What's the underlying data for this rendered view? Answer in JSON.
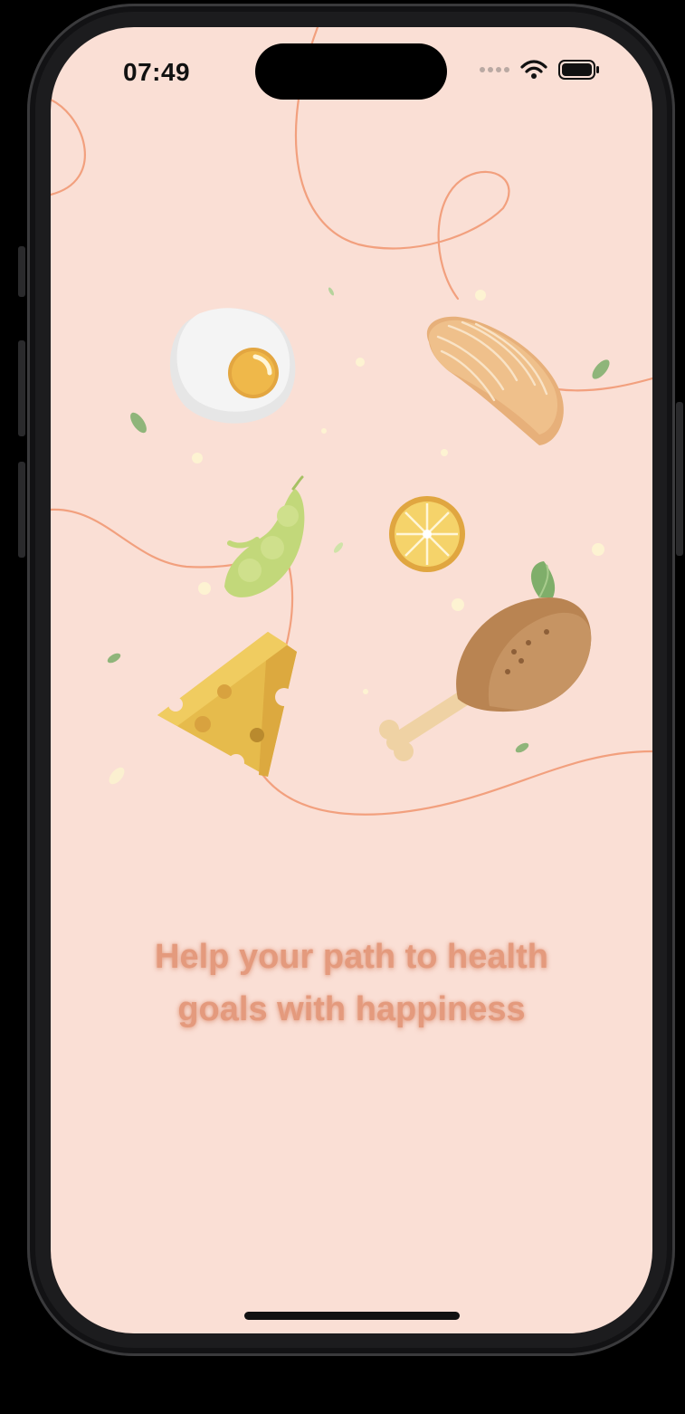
{
  "status_bar": {
    "time": "07:49",
    "icons": [
      "cellular-signal-icon",
      "wifi-icon",
      "battery-icon"
    ]
  },
  "onboarding": {
    "tagline_line1": "Help your path to health",
    "tagline_line2": "goals with happiness",
    "illustrations": [
      "fried-egg-icon",
      "salmon-fillet-icon",
      "edamame-icon",
      "lemon-slice-icon",
      "cheese-icon",
      "chicken-drumstick-icon"
    ]
  },
  "colors": {
    "background": "#fadfd5",
    "tagline": "#e49a7d",
    "line_accent": "#f2a07e"
  }
}
